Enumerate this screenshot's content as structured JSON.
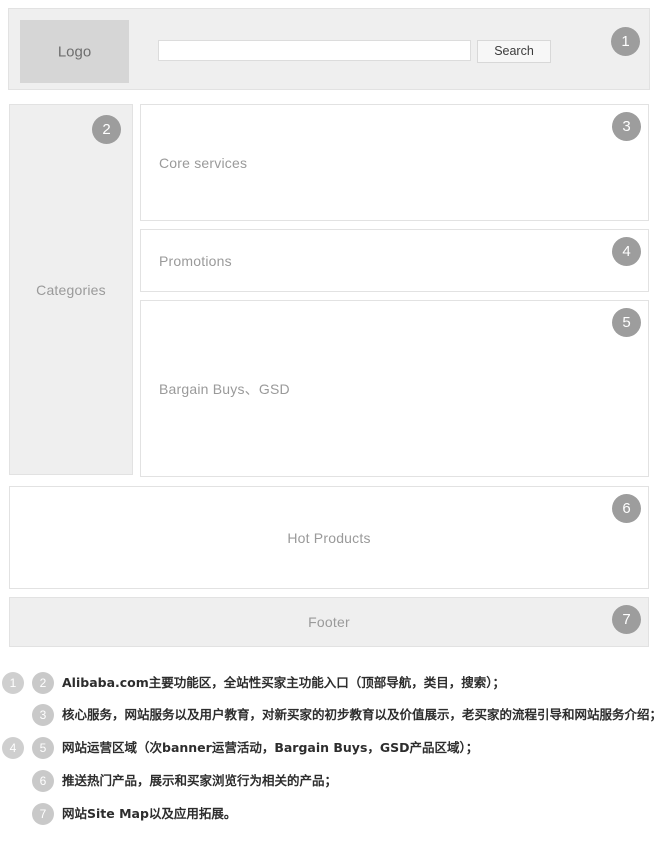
{
  "header": {
    "logo_label": "Logo",
    "search_value": "",
    "search_placeholder": "",
    "search_button_label": "Search",
    "badge": "1"
  },
  "sidebar": {
    "label": "Categories",
    "badge": "2"
  },
  "panels": [
    {
      "key": "core",
      "label": "Core services",
      "badge": "3",
      "align": "left"
    },
    {
      "key": "promos",
      "label": "Promotions",
      "badge": "4",
      "align": "left"
    },
    {
      "key": "bargain",
      "label": "Bargain Buys、GSD",
      "badge": "5",
      "align": "left"
    },
    {
      "key": "hot",
      "label": "Hot Products",
      "badge": "6",
      "align": "center"
    },
    {
      "key": "footer",
      "label": "Footer",
      "badge": "7",
      "align": "center"
    }
  ],
  "panel_labels": {
    "core": "Core services",
    "promos": "Promotions",
    "bargain": "Bargain Buys、GSD",
    "hot": "Hot Products",
    "footer": "Footer"
  },
  "panel_badges": {
    "core": "3",
    "promos": "4",
    "bargain": "5",
    "hot": "6",
    "footer": "7"
  },
  "legend": {
    "rows": [
      {
        "badges": [
          "1",
          "2"
        ],
        "text": "Alibaba.com主要功能区，全站性买家主功能入口（顶部导航，类目，搜索）；"
      },
      {
        "badges": [
          "3"
        ],
        "text": "核心服务，网站服务以及用户教育，对新买家的初步教育以及价值展示，老买家的流程引导和网站服务介绍；"
      },
      {
        "badges": [
          "4",
          "5"
        ],
        "text": "网站运营区域（次banner运营活动，Bargain Buys，GSD产品区域）；"
      },
      {
        "badges": [
          "6"
        ],
        "text": "推送热门产品，展示和买家浏览行为相关的产品；"
      },
      {
        "badges": [
          "7"
        ],
        "text": "网站Site Map以及应用拓展。"
      }
    ],
    "row_1_badge_a": "1",
    "row_1_badge_b": "2",
    "row_1_text": "Alibaba.com主要功能区，全站性买家主功能入口（顶部导航，类目，搜索）；",
    "row_2_badge_b": "3",
    "row_2_text": "核心服务，网站服务以及用户教育，对新买家的初步教育以及价值展示，老买家的流程引导和网站服务介绍；",
    "row_3_badge_a": "4",
    "row_3_badge_b": "5",
    "row_3_text": "网站运营区域（次banner运营活动，Bargain Buys，GSD产品区域）；",
    "row_4_badge_b": "6",
    "row_4_text": "推送热门产品，展示和买家浏览行为相关的产品；",
    "row_5_badge_b": "7",
    "row_5_text": "网站Site Map以及应用拓展。"
  },
  "colors": {
    "badge_fill": "#9d9d9d",
    "legend_badge_fill": "#c9c9c9",
    "panel_grey": "#efefef",
    "panel_white": "#ffffff",
    "panel_border": "#e2e2e2",
    "logo_fill": "#d6d6d6",
    "label_text": "#9a9a9a"
  }
}
